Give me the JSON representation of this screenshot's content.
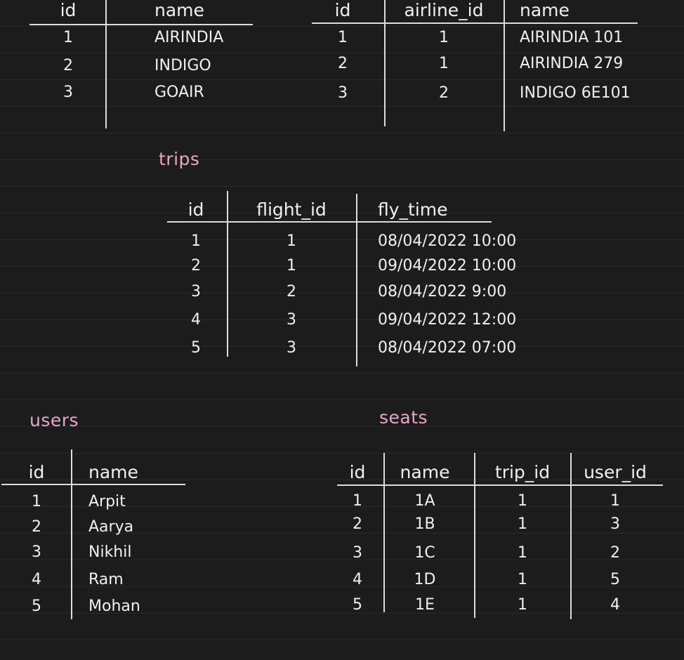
{
  "trips_title": "trips",
  "users_title": "users",
  "seats_title": "seats",
  "airlines": {
    "headers": [
      "id",
      "name"
    ],
    "rows": [
      [
        "1",
        "AIRINDIA"
      ],
      [
        "2",
        "INDIGO"
      ],
      [
        "3",
        "GOAIR"
      ]
    ]
  },
  "flights": {
    "headers": [
      "id",
      "airline_id",
      "name"
    ],
    "rows": [
      [
        "1",
        "1",
        "AIRINDIA 101"
      ],
      [
        "2",
        "1",
        "AIRINDIA 279"
      ],
      [
        "3",
        "2",
        "INDIGO 6E101"
      ]
    ]
  },
  "trips": {
    "headers": [
      "id",
      "flight_id",
      "fly_time"
    ],
    "rows": [
      [
        "1",
        "1",
        "08/04/2022 10:00"
      ],
      [
        "2",
        "1",
        "09/04/2022 10:00"
      ],
      [
        "3",
        "2",
        "08/04/2022 9:00"
      ],
      [
        "4",
        "3",
        "09/04/2022 12:00"
      ],
      [
        "5",
        "3",
        "08/04/2022 07:00"
      ]
    ]
  },
  "users": {
    "headers": [
      "id",
      "name"
    ],
    "rows": [
      [
        "1",
        "Arpit"
      ],
      [
        "2",
        "Aarya"
      ],
      [
        "3",
        "Nikhil"
      ],
      [
        "4",
        "Ram"
      ],
      [
        "5",
        "Mohan"
      ]
    ]
  },
  "seats": {
    "headers": [
      "id",
      "name",
      "trip_id",
      "user_id"
    ],
    "rows": [
      [
        "1",
        "1A",
        "1",
        "1"
      ],
      [
        "2",
        "1B",
        "1",
        "3"
      ],
      [
        "3",
        "1C",
        "1",
        "2"
      ],
      [
        "4",
        "1D",
        "1",
        "5"
      ],
      [
        "5",
        "1E",
        "1",
        "4"
      ]
    ]
  },
  "colors": {
    "background": "#1c1c1c",
    "ink": "#f0f0f0",
    "title": "#e8a6c9"
  }
}
